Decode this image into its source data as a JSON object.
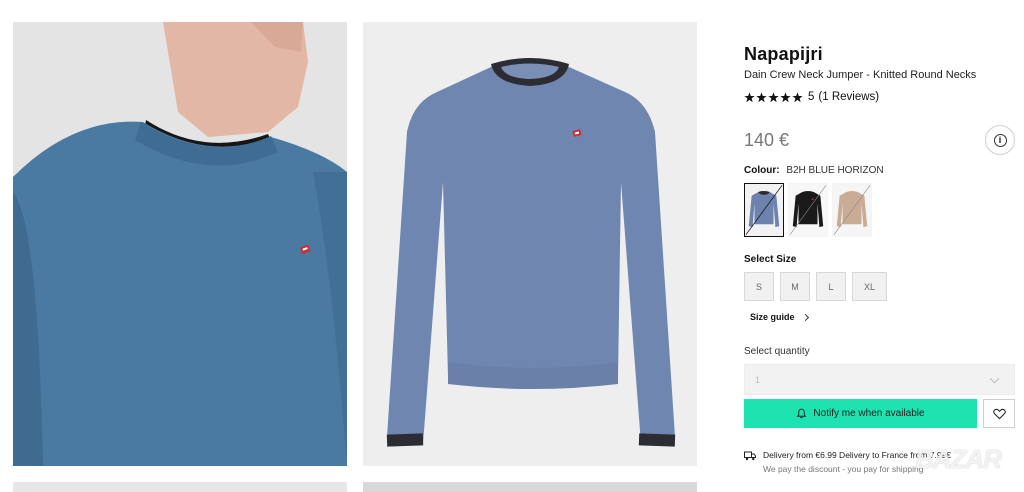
{
  "product": {
    "brand": "Napapijri",
    "name": "Dain Crew Neck Jumper - Knitted Round Necks",
    "rating": {
      "stars": 5,
      "score_text": "5",
      "reviews_text": "(1 Reviews)"
    },
    "price": "140 €"
  },
  "colour": {
    "label": "Colour:",
    "value": "B2H BLUE HORIZON",
    "swatches": [
      {
        "name": "blue-horizon",
        "color": "#6d83ad",
        "selected": true
      },
      {
        "name": "black",
        "color": "#1a1a1a",
        "selected": false
      },
      {
        "name": "beige",
        "color": "#c9ab96",
        "selected": false
      }
    ]
  },
  "size": {
    "label": "Select Size",
    "options": [
      "S",
      "M",
      "L",
      "XL"
    ],
    "guide_label": "Size guide"
  },
  "quantity": {
    "label": "Select quantity",
    "value": "1"
  },
  "actions": {
    "notify_label": "Notify me when available",
    "wishlist_icon": "heart-icon",
    "info_icon": "info-icon"
  },
  "delivery": {
    "line1": "Delivery from €6.99 Delivery to France from 7.99€",
    "line2": "We pay the discount - you pay for shipping"
  },
  "watermark": "BAZAR",
  "colors": {
    "accent": "#1fe2b1",
    "price": "#777777",
    "jumper_blue": "#4c7aa3"
  }
}
